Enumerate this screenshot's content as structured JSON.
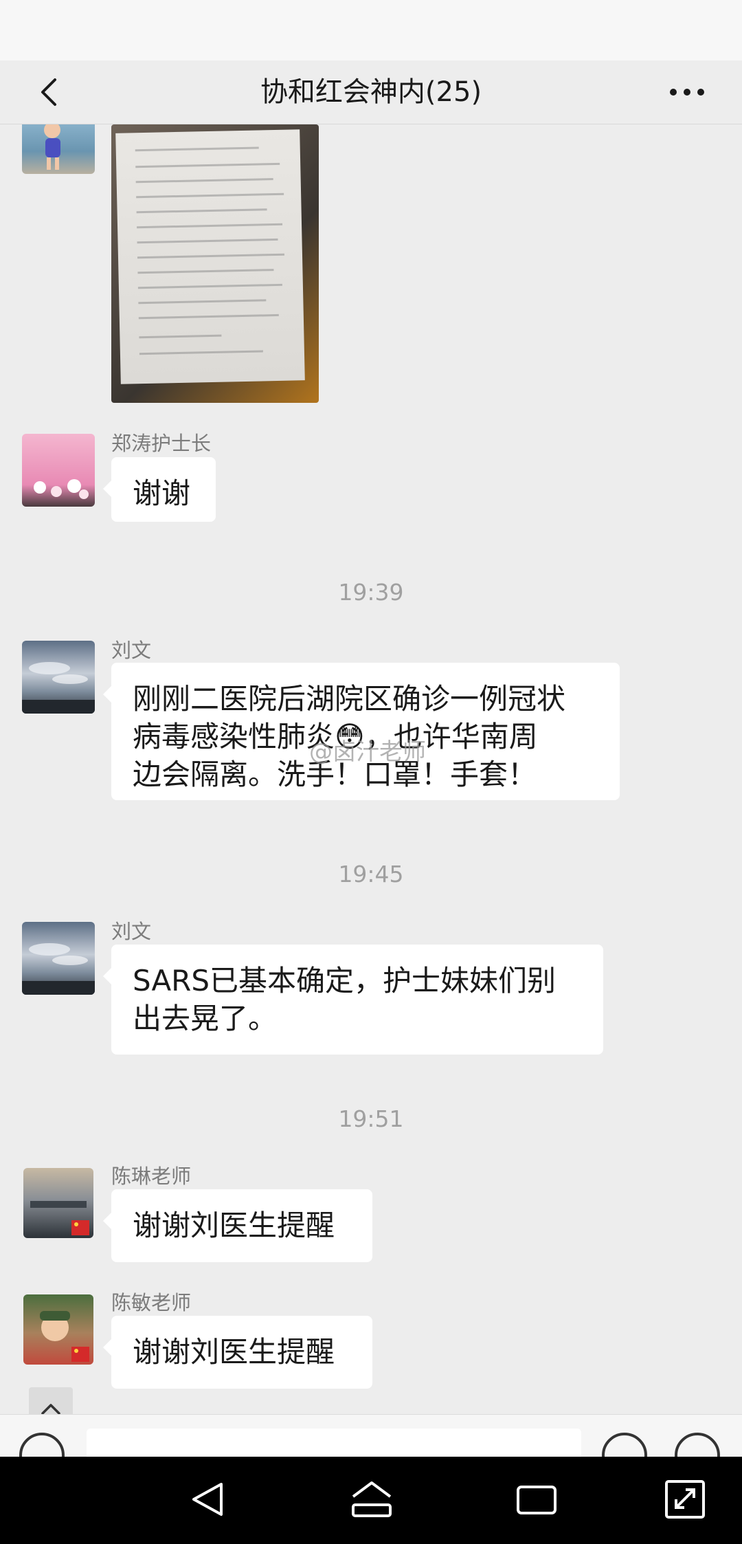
{
  "header": {
    "title": "协和红会神内(25)",
    "back_icon": "chevron-left-icon",
    "more_icon": "more-dots-icon"
  },
  "messages": [
    {
      "type": "image",
      "sender": "",
      "content": "document-photo"
    },
    {
      "type": "text",
      "sender": "郑涛护士长",
      "text": "谢谢"
    },
    {
      "type": "time",
      "text": "19:39"
    },
    {
      "type": "text",
      "sender": "刘文",
      "lines": [
        "刚刚二医院后湖院区确诊一例冠状",
        "病毒感染性肺炎😳，也许华南周",
        "边会隔离。洗手！口罩！手套！"
      ]
    },
    {
      "type": "time",
      "text": "19:45"
    },
    {
      "type": "text",
      "sender": "刘文",
      "lines": [
        "SARS已基本确定，护士妹妹们别",
        "出去晃了。"
      ]
    },
    {
      "type": "time",
      "text": "19:51"
    },
    {
      "type": "text",
      "sender": "陈琳老师",
      "text": "谢谢刘医生提醒"
    },
    {
      "type": "text",
      "sender": "陈敏老师",
      "text": "谢谢刘医生提醒"
    }
  ],
  "watermark": "@卤汁老师",
  "colors": {
    "background": "#ededed",
    "bubble": "#ffffff",
    "sender_text": "#7c7c7c",
    "timestamp_text": "#a0a0a0",
    "nav_bar": "#000000"
  },
  "navbar": {
    "icons": [
      "back-triangle-icon",
      "home-icon",
      "recent-apps-icon",
      "screen-rotate-icon"
    ]
  }
}
